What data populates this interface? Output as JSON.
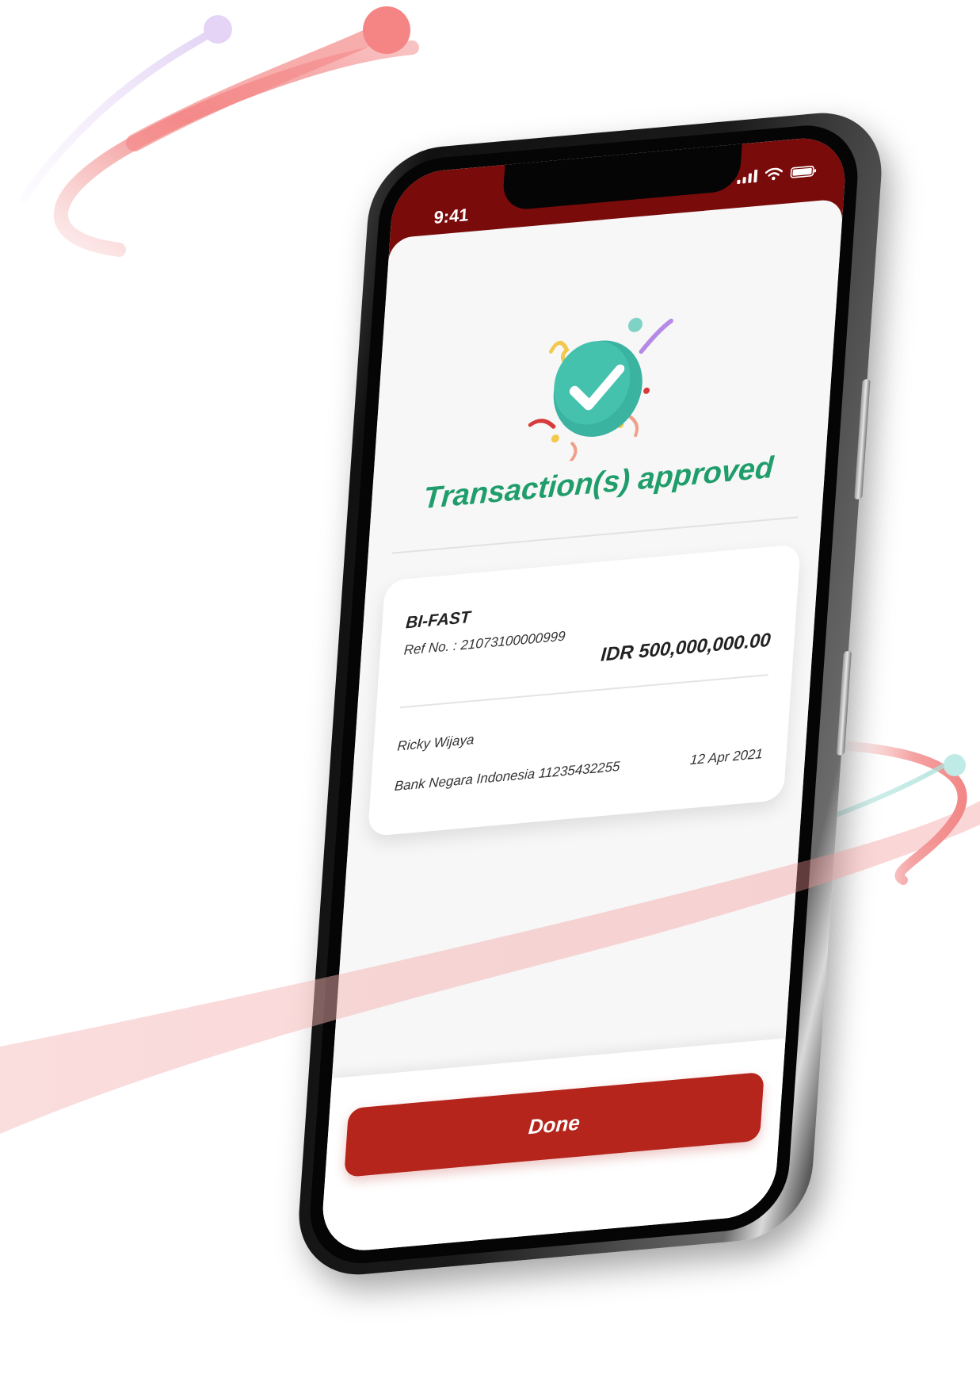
{
  "status_bar": {
    "time": "9:41",
    "signal_icon": "cellular-signal-icon",
    "wifi_icon": "wifi-icon",
    "battery_icon": "battery-icon"
  },
  "success": {
    "icon": "checkmark-badge-icon",
    "headline": "Transaction(s) approved"
  },
  "transaction": {
    "type": "BI-FAST",
    "ref": "Ref No. : 21073100000999",
    "amount": "IDR 500,000,000.00",
    "recipient_name": "Ricky Wijaya",
    "recipient_bank": "Bank Negara Indonesia 11235432255",
    "date": "12 Apr 2021"
  },
  "actions": {
    "done_label": "Done"
  },
  "colors": {
    "status_bar_bg": "#7a0b0b",
    "success_green": "#1f9d6b",
    "badge_teal": "#3bb3a1",
    "primary_button": "#b5251c",
    "swoosh_red": "#f07a7a"
  }
}
